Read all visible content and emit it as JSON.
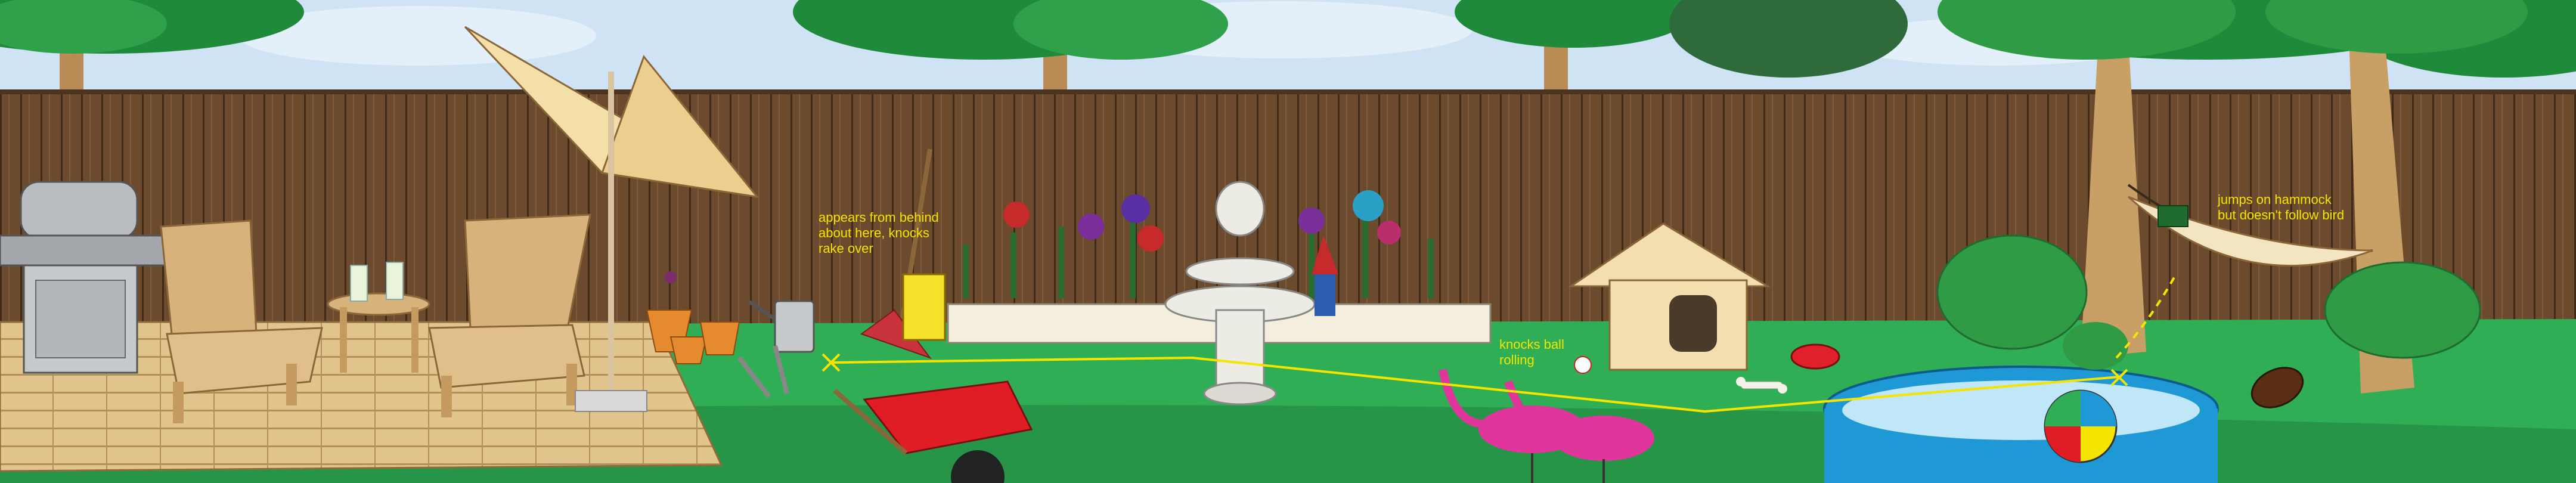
{
  "scene": {
    "colors": {
      "sky": "#cfe3f5",
      "fence": "#6b4a2e",
      "grass": "#2fae55",
      "annotation": "#f4e400",
      "deck": "#e2c48d",
      "pool": "#1f98d6",
      "wheelbarrow": "#e01c24",
      "flamingo": "#e0369b"
    },
    "objects": [
      "grill",
      "adirondack-chair",
      "side-table",
      "drinks",
      "patio-umbrella",
      "wooden-deck",
      "flower-pots",
      "watering-can",
      "garden-rake",
      "seed-sign",
      "trowel",
      "wheelbarrow",
      "flower-bed",
      "fountain",
      "garden-gnome",
      "dog-house",
      "dog-bowl",
      "bone",
      "baseball",
      "pink-flamingos",
      "kiddie-pool",
      "beach-ball",
      "hammock",
      "shrub",
      "football",
      "trees",
      "wooden-fence"
    ]
  },
  "annotations": {
    "rake": "appears from behind\nabout here, knocks\nrake over",
    "ball": "knocks ball\nrolling",
    "hammock": "jumps on hammock\nbut doesn't follow bird"
  }
}
